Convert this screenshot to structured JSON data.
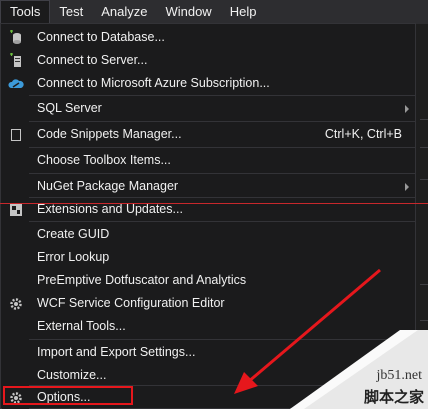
{
  "menubar": {
    "items": [
      {
        "label": "Tools"
      },
      {
        "label": "Test"
      },
      {
        "label": "Analyze"
      },
      {
        "label": "Window"
      },
      {
        "label": "Help"
      }
    ]
  },
  "menu": {
    "items": [
      {
        "label": "Connect to Database...",
        "icon": "database-icon"
      },
      {
        "label": "Connect to Server...",
        "icon": "server-icon"
      },
      {
        "label": "Connect to Microsoft Azure Subscription...",
        "icon": "azure-cloud-icon"
      },
      {
        "label": "SQL Server"
      },
      {
        "label": "Code Snippets Manager...",
        "shortcut": "Ctrl+K, Ctrl+B",
        "icon": "snippet-icon"
      },
      {
        "label": "Choose Toolbox Items..."
      },
      {
        "label": "NuGet Package Manager"
      },
      {
        "label": "Extensions and Updates...",
        "icon": "extensions-icon"
      },
      {
        "label": "Create GUID"
      },
      {
        "label": "Error Lookup"
      },
      {
        "label": "PreEmptive Dotfuscator and Analytics"
      },
      {
        "label": "WCF Service Configuration Editor",
        "icon": "gear-icon"
      },
      {
        "label": "External Tools..."
      },
      {
        "label": "Import and Export Settings..."
      },
      {
        "label": "Customize..."
      },
      {
        "label": "Options...",
        "icon": "gear-icon"
      }
    ]
  },
  "watermark": {
    "url": "jb51.net",
    "text": "脚本之家"
  },
  "colors": {
    "annotation": "#e6171c",
    "menu_bg": "#1b1b1c"
  }
}
